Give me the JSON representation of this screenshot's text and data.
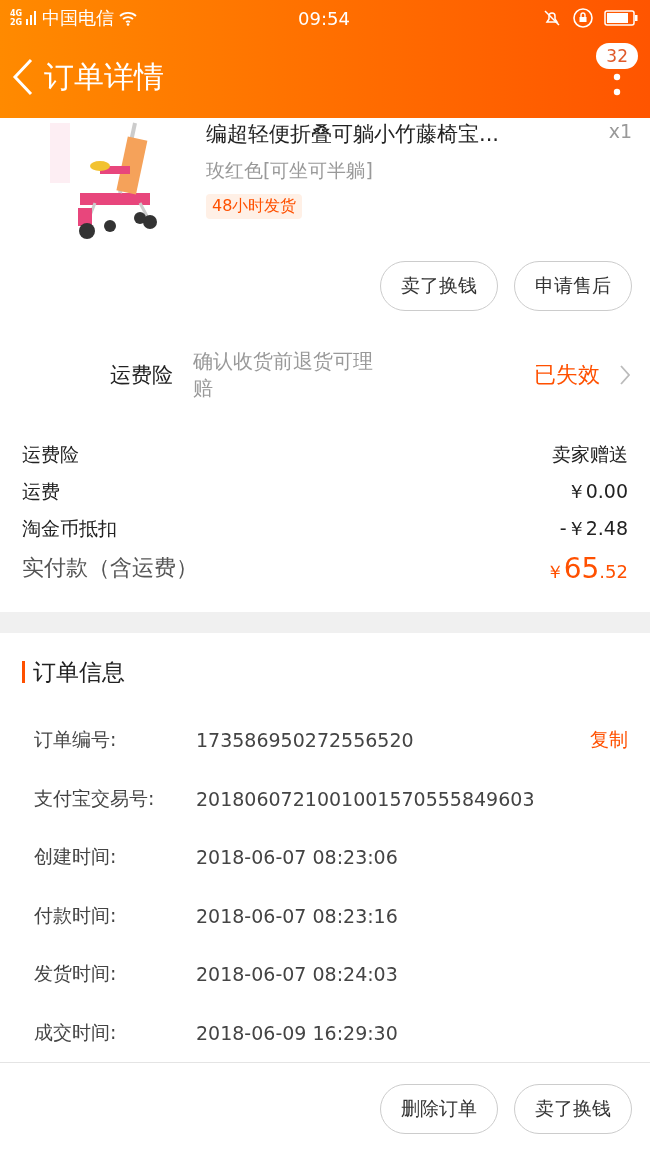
{
  "status_bar": {
    "network_top": "4G",
    "network_bottom": "2G",
    "carrier": "中国电信",
    "time": "09:54"
  },
  "header": {
    "title": "订单详情",
    "badge": "32"
  },
  "product": {
    "title": "编超轻便折叠可躺小竹藤椅宝...",
    "quantity": "x1",
    "variant": "玫红色[可坐可半躺]",
    "tag": "48小时发货"
  },
  "item_actions": [
    "卖了换钱",
    "申请售后"
  ],
  "insurance": {
    "label": "运费险",
    "description": "确认收货前退货可理赔",
    "status": "已失效"
  },
  "fees": [
    {
      "label": "运费险",
      "value": "卖家赠送"
    },
    {
      "label": "运费",
      "value": "￥0.00"
    },
    {
      "label": "淘金币抵扣",
      "value": "-￥2.48"
    }
  ],
  "total": {
    "label": "实付款（含运费）",
    "symbol": "￥",
    "main": "65",
    "fraction": ".52"
  },
  "order_info": {
    "title": "订单信息",
    "copy": "复制",
    "rows": [
      {
        "label": "订单编号:",
        "value": "173586950272556520"
      },
      {
        "label": "支付宝交易号:",
        "value": "2018060721001001570555849603"
      },
      {
        "label": "创建时间:",
        "value": "2018-06-07 08:23:06"
      },
      {
        "label": "付款时间:",
        "value": "2018-06-07 08:23:16"
      },
      {
        "label": "发货时间:",
        "value": "2018-06-07 08:24:03"
      },
      {
        "label": "成交时间:",
        "value": "2018-06-09 16:29:30"
      }
    ]
  },
  "bottom_actions": [
    "删除订单",
    "卖了换钱"
  ]
}
